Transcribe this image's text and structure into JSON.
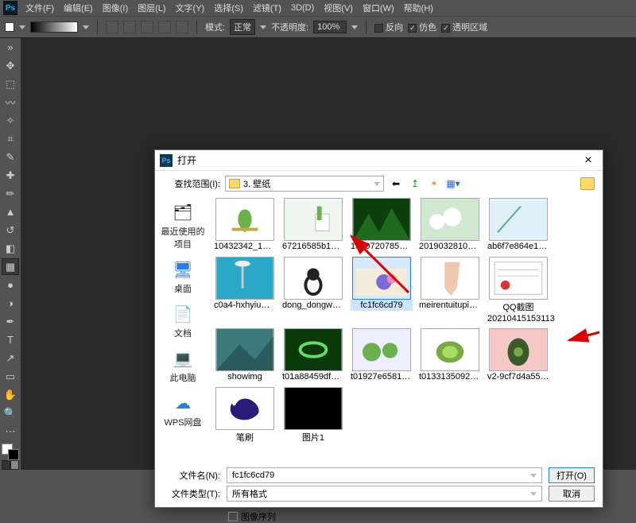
{
  "menu": {
    "items": [
      "文件(F)",
      "编辑(E)",
      "图像(I)",
      "图层(L)",
      "文字(Y)",
      "选择(S)",
      "滤镜(T)",
      "3D(D)",
      "视图(V)",
      "窗口(W)",
      "帮助(H)"
    ]
  },
  "optbar": {
    "mode_label": "模式:",
    "mode_value": "正常",
    "opacity_label": "不透明度:",
    "opacity_value": "100%",
    "cb_reverse": "反向",
    "cb_dither": "仿色",
    "cb_transp": "透明区域"
  },
  "tools": [
    "↖",
    "⬚",
    "⊕",
    "✂",
    "✎",
    "✆",
    "✚",
    "✏",
    "⌃",
    "▲",
    "⬤",
    "◍",
    "▦",
    "◧",
    "◑",
    "✥",
    "⟲",
    "✎",
    "T",
    "↗",
    "□",
    "✋",
    "🔍"
  ],
  "dialog": {
    "title": "打开",
    "lookin_label": "查找范围(I):",
    "folder": "3. 壁纸",
    "filename_label": "文件名(N):",
    "filename_value": "fc1fc6cd79",
    "filetype_label": "文件类型(T):",
    "filetype_value": "所有格式",
    "open_btn": "打开(O)",
    "cancel_btn": "取消",
    "seq_label": "图像序列"
  },
  "places": [
    {
      "label": "最近使用的项目",
      "icon": "🗂"
    },
    {
      "label": "桌面",
      "icon": "🖥"
    },
    {
      "label": "文档",
      "icon": "📄"
    },
    {
      "label": "此电脑",
      "icon": "💻"
    },
    {
      "label": "WPS网盘",
      "icon": "☁"
    }
  ],
  "files_row1": [
    {
      "name": "10432342_130…"
    },
    {
      "name": "67216585b1e5…"
    },
    {
      "name": "15407207854…"
    },
    {
      "name": "20190328101255…"
    },
    {
      "name": "ab6f7e864e17…"
    },
    {
      "name": "c0a4-hxhyium9…"
    }
  ],
  "files_row2": [
    {
      "name": "dong_dongwu…"
    },
    {
      "name": "fc1fc6cd79",
      "selected": true
    },
    {
      "name": "meirentuitupia…"
    },
    {
      "name": "QQ截图",
      "name2": "20210415153113"
    },
    {
      "name": "showimg"
    },
    {
      "name": "t01a88459df4e…"
    }
  ],
  "files_row3": [
    {
      "name": "t01927e65817f…"
    },
    {
      "name": "t01331350923…"
    },
    {
      "name": "v2-9cf7d4a557…"
    },
    {
      "name": "笔刷"
    },
    {
      "name": "图片1"
    }
  ]
}
